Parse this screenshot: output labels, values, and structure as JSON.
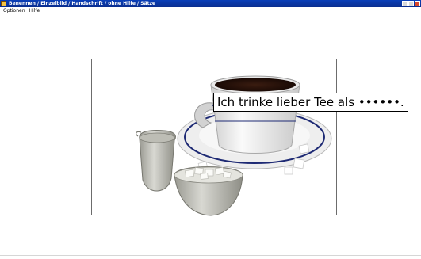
{
  "window": {
    "title": "Benennen / Einzelbild / Handschrift / ohne Hilfe / Sätze"
  },
  "menu": {
    "items": [
      "Optionen",
      "Hilfe"
    ]
  },
  "exercise": {
    "sentence": "Ich trinke lieber Tee als ••••••."
  }
}
